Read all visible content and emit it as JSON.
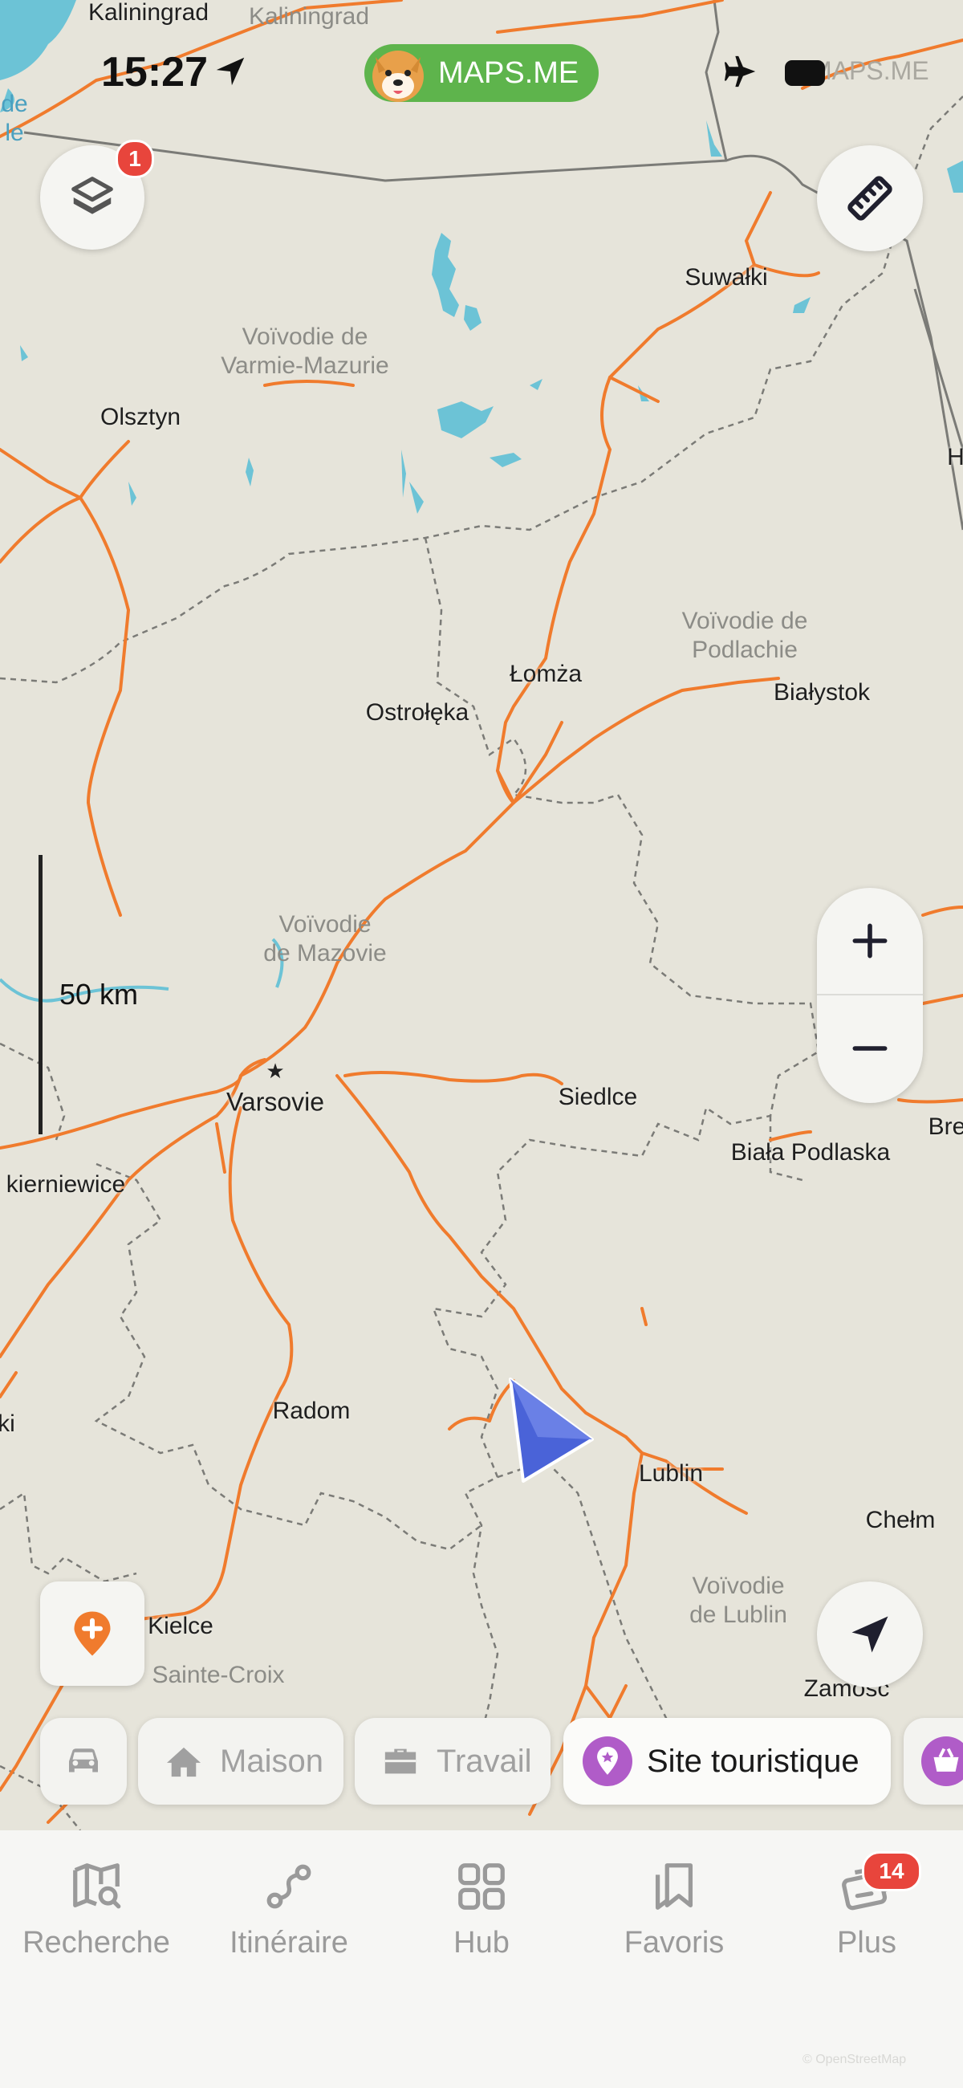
{
  "status_bar": {
    "time": "15:27",
    "app_name": "MAPS.ME",
    "ghost_text": "MAPS.ME",
    "icons": [
      "location-arrow-icon",
      "airplane-icon",
      "battery-icon"
    ]
  },
  "map": {
    "cities": [
      {
        "name": "Kaliningrad",
        "id": "kaliningrad"
      },
      {
        "name": "Suwałki",
        "id": "suwalki"
      },
      {
        "name": "Olsztyn",
        "id": "olsztyn"
      },
      {
        "name": "Łomża",
        "id": "lomza"
      },
      {
        "name": "Ostrołęka",
        "id": "ostroleka"
      },
      {
        "name": "Białystok",
        "id": "bialystok"
      },
      {
        "name": "Varsovie",
        "id": "varsovie"
      },
      {
        "name": "Siedlce",
        "id": "siedlce"
      },
      {
        "name": "Biała Podlaska",
        "id": "biala-podlaska"
      },
      {
        "name": "kierniewice",
        "id": "skierniewice"
      },
      {
        "name": "Radom",
        "id": "radom"
      },
      {
        "name": "Lublin",
        "id": "lublin"
      },
      {
        "name": "Chełm",
        "id": "chelm"
      },
      {
        "name": "Kielce",
        "id": "kielce"
      },
      {
        "name": "Zamosc",
        "id": "zamosc"
      },
      {
        "name": "Bre",
        "id": "brest"
      },
      {
        "name": "ki",
        "id": "edge-ki"
      },
      {
        "name": "H",
        "id": "edge-h"
      }
    ],
    "regions": [
      {
        "name": "Kaliningrad",
        "id": "kaliningrad-region"
      },
      {
        "name": "Voïvodie de\nVarmie-Mazurie",
        "id": "varmie-mazurie"
      },
      {
        "name": "Voïvodie de\nPodlachie",
        "id": "podlachie"
      },
      {
        "name": "Voïvodie\nde Mazovie",
        "id": "mazovie"
      },
      {
        "name": "Voïvodie\nde Lublin",
        "id": "lublin-region"
      },
      {
        "name": "Sainte-Croix",
        "id": "sainte-croix"
      },
      {
        "name": "de\nle",
        "id": "edge-de-le"
      }
    ],
    "scale_label": "50 km"
  },
  "controls": {
    "layers_badge": "1",
    "zoom_in": "+",
    "zoom_out": "−"
  },
  "chips": [
    {
      "label": "",
      "icon": "car-icon"
    },
    {
      "label": "Maison",
      "icon": "home-icon"
    },
    {
      "label": "Travail",
      "icon": "briefcase-icon"
    },
    {
      "label": "Site touristique",
      "icon": "star-pin-icon"
    },
    {
      "label": "",
      "icon": "basket-icon"
    }
  ],
  "tabbar": {
    "tabs": [
      {
        "label": "Recherche",
        "icon": "map-search-icon"
      },
      {
        "label": "Itinéraire",
        "icon": "route-icon"
      },
      {
        "label": "Hub",
        "icon": "grid-icon"
      },
      {
        "label": "Favoris",
        "icon": "bookmarks-icon"
      },
      {
        "label": "Plus",
        "icon": "tickets-icon",
        "badge": "14"
      }
    ]
  },
  "copyright": "© OpenStreetMap"
}
